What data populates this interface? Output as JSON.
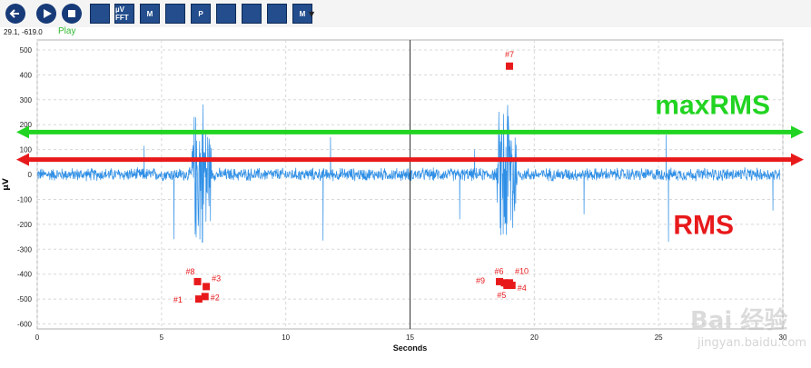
{
  "toolbar": {
    "buttons": [
      {
        "name": "back-button",
        "icon": "back-arrow-icon"
      },
      {
        "name": "play-button",
        "icon": "play-icon"
      },
      {
        "name": "stop-button",
        "icon": "stop-icon"
      },
      {
        "name": "report-button",
        "icon": "report-icon"
      },
      {
        "name": "uv-fft-button",
        "label": "µV FFT",
        "icon": "fft-icon"
      },
      {
        "name": "marker-button",
        "label": "M",
        "icon": "marker-icon"
      },
      {
        "name": "bar-analysis-button",
        "icon": "bar-analysis-icon"
      },
      {
        "name": "peak-button",
        "label": "P",
        "icon": "peak-icon"
      },
      {
        "name": "slope-button",
        "icon": "slope-icon"
      },
      {
        "name": "eraser-button",
        "icon": "eraser-icon"
      },
      {
        "name": "image-button",
        "icon": "image-icon"
      },
      {
        "name": "marker-settings-button",
        "label": "M",
        "icon": "marker-settings-icon"
      }
    ]
  },
  "status": {
    "coordinates": "29.1, -619.0",
    "play": "Play",
    "play_color": "#2eb82e"
  },
  "chart_data": {
    "type": "line",
    "xlabel": "Seconds",
    "ylabel": "µV",
    "xlim": [
      0,
      30
    ],
    "ylim": [
      -620,
      540
    ],
    "x_ticks": [
      0,
      5,
      10,
      15,
      20,
      25,
      30
    ],
    "y_ticks": [
      -600,
      -500,
      -400,
      -300,
      -200,
      -100,
      0,
      100,
      200,
      300,
      400,
      500
    ],
    "grid": true,
    "cursor_x": 15,
    "series": [
      {
        "color": "#2f8fe6",
        "baseline_noise": 30,
        "bursts": [
          {
            "x0": 6.2,
            "x1": 7.0,
            "amplitude": 380
          },
          {
            "x0": 18.5,
            "x1": 19.3,
            "amplitude": 430
          }
        ],
        "spikes": [
          {
            "x": 4.3,
            "value": 115
          },
          {
            "x": 5.5,
            "value": -260
          },
          {
            "x": 11.5,
            "value": -265
          },
          {
            "x": 11.8,
            "value": 150
          },
          {
            "x": 17.0,
            "value": -180
          },
          {
            "x": 17.6,
            "value": 100
          },
          {
            "x": 22.0,
            "value": -160
          },
          {
            "x": 25.3,
            "value": 160
          },
          {
            "x": 25.4,
            "value": -270
          },
          {
            "x": 29.6,
            "value": -145
          }
        ]
      }
    ],
    "markers": [
      {
        "label": "#1",
        "x": 6.5,
        "value": -500
      },
      {
        "label": "#2",
        "x": 6.75,
        "value": -490
      },
      {
        "label": "#3",
        "x": 6.8,
        "value": -450
      },
      {
        "label": "#8",
        "x": 6.45,
        "value": -430
      },
      {
        "label": "#7",
        "x": 19.0,
        "value": 435
      },
      {
        "label": "#9",
        "x": 18.6,
        "value": -430
      },
      {
        "label": "#6",
        "x": 18.8,
        "value": -435
      },
      {
        "label": "#10",
        "x": 19.0,
        "value": -435
      },
      {
        "label": "#5",
        "x": 18.9,
        "value": -445
      },
      {
        "label": "#4",
        "x": 19.1,
        "value": -445
      }
    ],
    "marker_color": "#e8191b",
    "annotations": [
      {
        "name": "maxrms",
        "label": "maxRMS",
        "value": 170,
        "color": "#22d422"
      },
      {
        "name": "rms",
        "label": "RMS",
        "value": 60,
        "color": "#e8191b"
      }
    ]
  },
  "watermark": {
    "text": "Bai 经验",
    "url": "jingyan.baidu.com"
  }
}
